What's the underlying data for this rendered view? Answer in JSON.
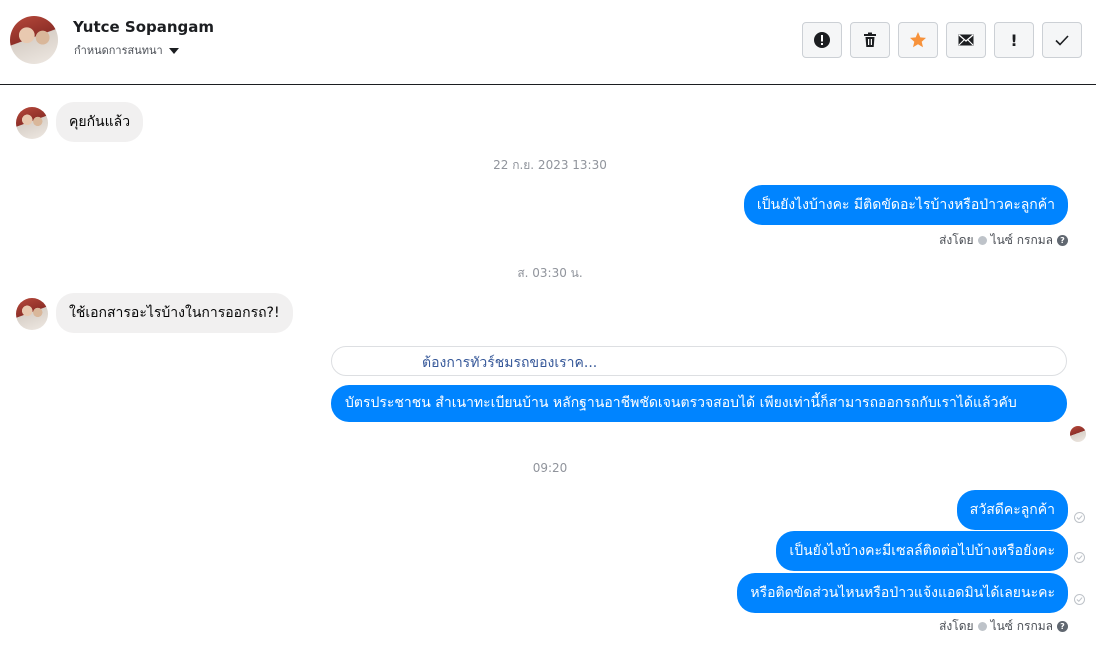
{
  "header": {
    "contact_name": "Yutce Sopangam",
    "subtitle": "กำหนดการสนทนา",
    "toolbar": [
      {
        "name": "spam-button",
        "icon": "alert-circle-icon"
      },
      {
        "name": "delete-button",
        "icon": "trash-icon"
      },
      {
        "name": "star-button",
        "icon": "star-icon"
      },
      {
        "name": "unread-button",
        "icon": "envelope-icon"
      },
      {
        "name": "important-button",
        "icon": "exclamation-icon"
      },
      {
        "name": "done-button",
        "icon": "check-icon"
      }
    ]
  },
  "colors": {
    "accent": "#0084ff",
    "incoming_bubble": "#f1f0f0",
    "star": "#f7923b"
  },
  "messages": {
    "m1": "คุยกันแล้ว",
    "ts1": "22 ก.ย. 2023 13:30",
    "m2": "เป็นยังไงบ้างคะ มีติดขัดอะไรบ้างหรือป่าวคะลูกค้า",
    "sent_by_1": "ส่งโดย",
    "sender_1": "ไนซ์ กรกมล",
    "ts2": "ส. 03:30 น.",
    "m3": "ใช้เอกสารอะไรบ้างในการออกรถ?!",
    "link_card": "ต้องการทัวร์ชมรถของเราค...",
    "m4": "บัตรประชาชน สำเนาทะเบียนบ้าน หลักฐานอาชีพชัดเจนตรวจสอบได้ เพียงเท่านี้ก็สามารถออกรถกับเราได้แล้วคับ",
    "ts3": "09:20",
    "m5": "สวัสดีคะลูกค้า",
    "m6": "เป็นยังไงบ้างคะมีเซลล์ติดต่อไปบ้างหรือยังคะ",
    "m7": "หรือติดขัดส่วนไหนหรือป่าวแจ้งแอดมินได้เลยนะคะ",
    "sent_by_2": "ส่งโดย",
    "sender_2": "ไนซ์ กรกมล"
  }
}
